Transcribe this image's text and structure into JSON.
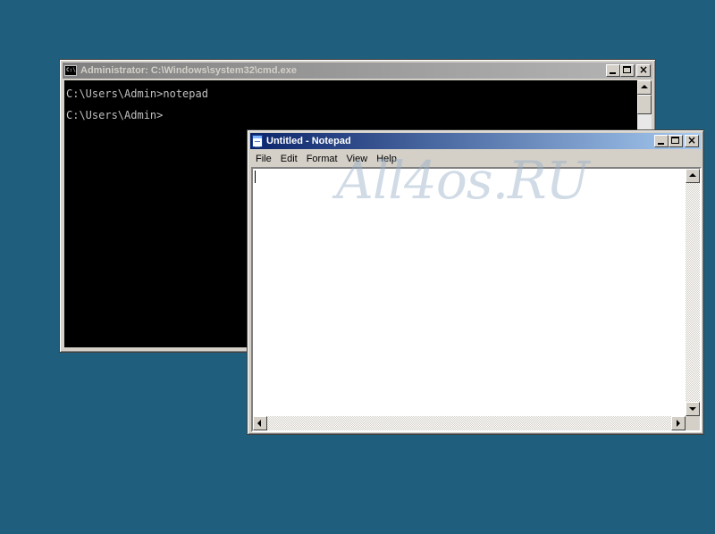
{
  "cmd_window": {
    "title": "Administrator: C:\\Windows\\system32\\cmd.exe",
    "icon_label": "C:\\",
    "lines": [
      "C:\\Users\\Admin>notepad",
      "C:\\Users\\Admin>"
    ]
  },
  "notepad_window": {
    "title": "Untitled - Notepad",
    "menu": [
      "File",
      "Edit",
      "Format",
      "View",
      "Help"
    ],
    "content": ""
  },
  "watermark": "All4os.RU",
  "colors": {
    "desktop": "#1f5f7d",
    "active_title": "#0a246a",
    "inactive_title": "#808080",
    "window_face": "#d4d0c8"
  }
}
